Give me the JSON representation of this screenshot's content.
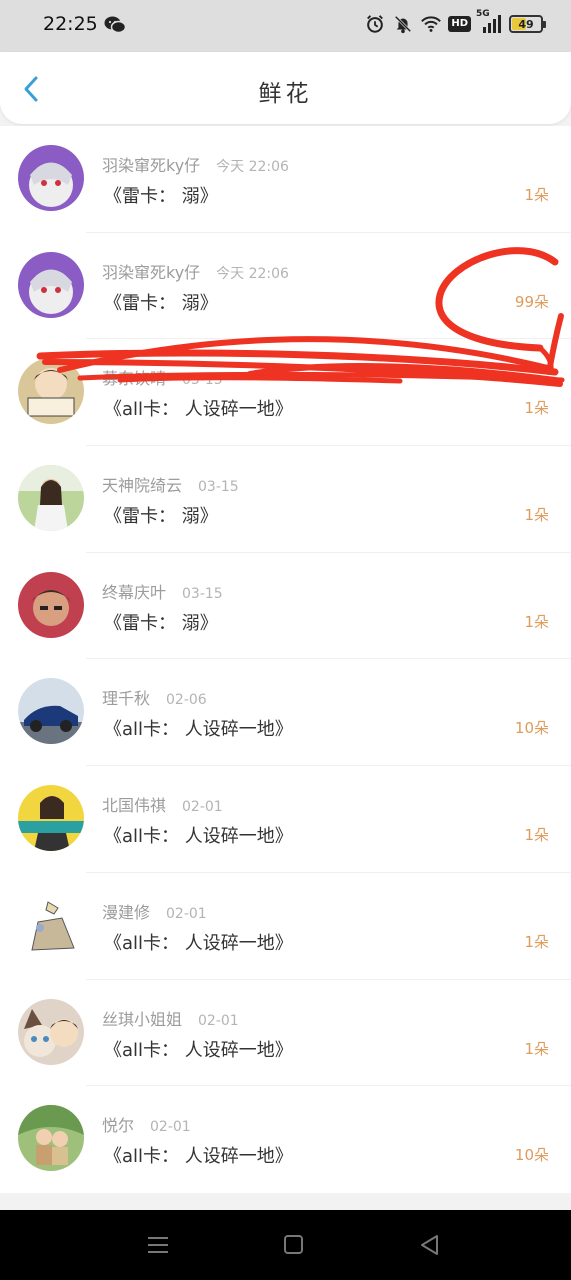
{
  "status_bar": {
    "time": "22:25",
    "battery": "49",
    "battery_level": 0.49,
    "network": "5G",
    "hd": "HD",
    "icons": [
      "wechat-icon",
      "alarm-icon",
      "mute-icon",
      "wifi-icon",
      "hd-icon",
      "signal-icon",
      "battery-icon"
    ]
  },
  "nav": {
    "title": "鲜花",
    "back_icon": "chevron-left-icon"
  },
  "colors": {
    "accent": "#3a9fd8",
    "count": "#dd9b5c",
    "scribble": "#ee3322"
  },
  "records": [
    {
      "name": "羽染窜死ky仔",
      "date": "今天 22:06",
      "item": "《雷卡： 溺》",
      "count": "1朵",
      "avatar": "anime-avatar-purple"
    },
    {
      "name": "羽染窜死ky仔",
      "date": "今天 22:06",
      "item": "《雷卡： 溺》",
      "count": "99朵",
      "avatar": "anime-avatar-purple"
    },
    {
      "name": "募东饮晴",
      "date": "03-15",
      "item": "《all卡： 人设碎一地》",
      "count": "1朵",
      "avatar": "cartoon-avatar-sign"
    },
    {
      "name": "天神院绮云",
      "date": "03-15",
      "item": "《雷卡： 溺》",
      "count": "1朵",
      "avatar": "photo-avatar-girl"
    },
    {
      "name": "终幕庆叶",
      "date": "03-15",
      "item": "《雷卡： 溺》",
      "count": "1朵",
      "avatar": "anime-avatar-dark"
    },
    {
      "name": "理千秋",
      "date": "02-06",
      "item": "《all卡： 人设碎一地》",
      "count": "10朵",
      "avatar": "car-avatar"
    },
    {
      "name": "北国伟祺",
      "date": "02-01",
      "item": "《all卡： 人设碎一地》",
      "count": "1朵",
      "avatar": "yellow-avatar"
    },
    {
      "name": "漫建修",
      "date": "02-01",
      "item": "《all卡： 人设碎一地》",
      "count": "1朵",
      "avatar": "sketch-avatar"
    },
    {
      "name": "丝琪小姐姐",
      "date": "02-01",
      "item": "《all卡： 人设碎一地》",
      "count": "1朵",
      "avatar": "cat-avatar"
    },
    {
      "name": "悦尔",
      "date": "02-01",
      "item": "《all卡： 人设碎一地》",
      "count": "10朵",
      "avatar": "green-avatar"
    }
  ],
  "system_nav": {
    "icons": [
      "menu-icon",
      "home-icon",
      "back-icon"
    ]
  }
}
